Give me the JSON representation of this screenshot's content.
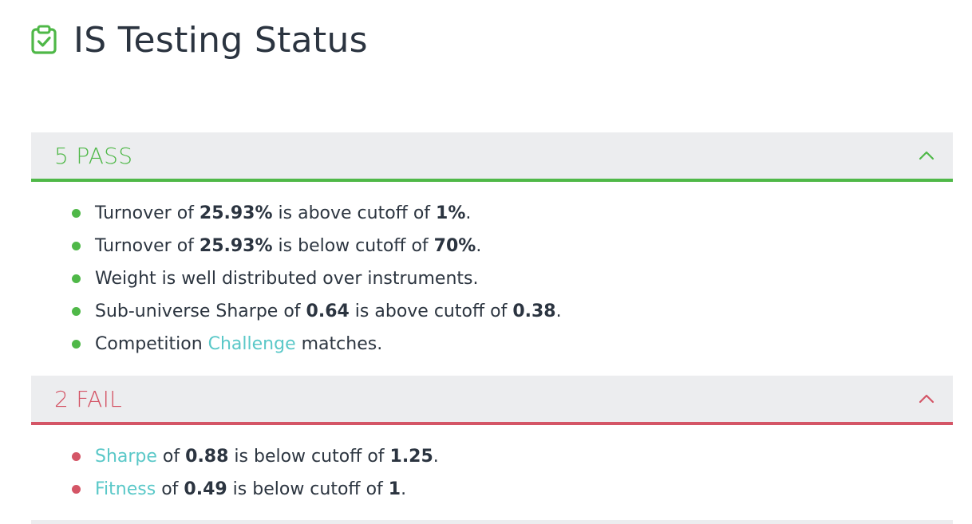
{
  "page": {
    "title": "IS Testing Status",
    "icon": "clipboard-check-icon",
    "accent_pass": "#4fb848",
    "accent_fail": "#d45566",
    "link_color": "#5ac8c8"
  },
  "pass_section": {
    "count": "5",
    "label": "PASS",
    "items": [
      {
        "t1": "Turnover of ",
        "v1": "25.93%",
        "t2": " is above cutoff of ",
        "v2": "1%",
        "t3": "."
      },
      {
        "t1": "Turnover of ",
        "v1": "25.93%",
        "t2": " is below cutoff of ",
        "v2": "70%",
        "t3": "."
      },
      {
        "text": "Weight is well distributed over instruments."
      },
      {
        "t1": "Sub-universe Sharpe of ",
        "v1": "0.64",
        "t2": " is above cutoff of ",
        "v2": "0.38",
        "t3": "."
      },
      {
        "pre": "Competition ",
        "link": "Challenge",
        "post": " matches."
      }
    ]
  },
  "fail_section": {
    "count": "2",
    "label": "FAIL",
    "items": [
      {
        "link": "Sharpe",
        "t1": " of ",
        "v1": "0.88",
        "t2": " is below cutoff of ",
        "v2": "1.25",
        "t3": "."
      },
      {
        "link": "Fitness",
        "t1": " of ",
        "v1": "0.49",
        "t2": " is below cutoff of ",
        "v2": "1",
        "t3": "."
      }
    ]
  }
}
